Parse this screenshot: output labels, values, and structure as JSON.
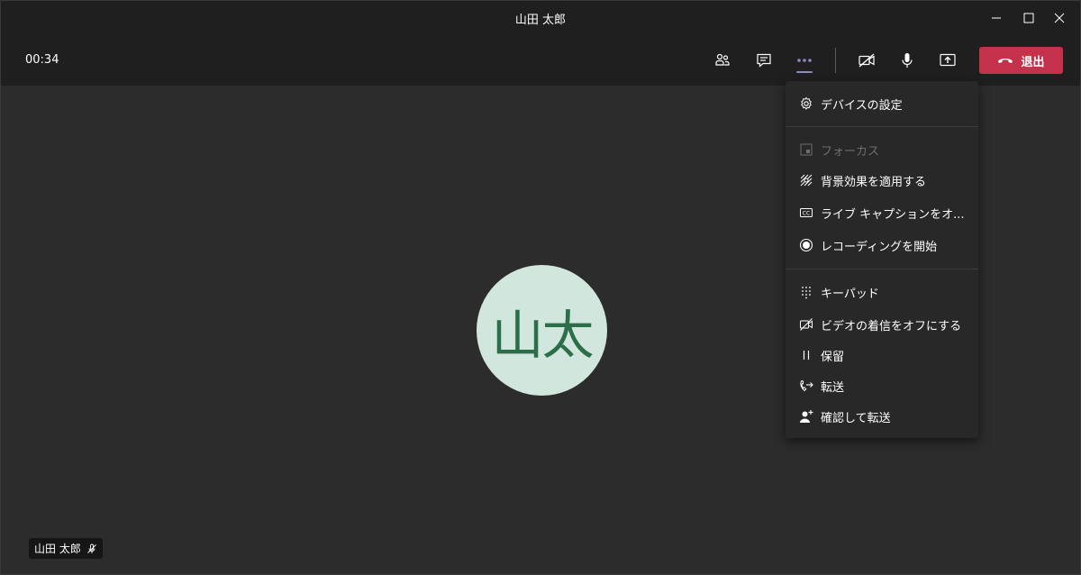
{
  "window": {
    "title": "山田 太郎"
  },
  "toolbar": {
    "timer": "00:34",
    "leave_label": "退出",
    "leave_color": "#c4314b",
    "icons": [
      "participants-icon",
      "chat-icon",
      "more-actions-icon",
      "camera-off-icon",
      "microphone-icon",
      "share-screen-icon"
    ]
  },
  "menu": {
    "items": [
      {
        "label": "デバイスの設定",
        "icon": "gear-icon"
      },
      {
        "label": "フォーカス",
        "icon": "focus-icon",
        "disabled": true
      },
      {
        "label": "背景効果を適用する",
        "icon": "background-effects-icon"
      },
      {
        "label": "ライブ キャプションをオ...",
        "icon": "cc-icon"
      },
      {
        "label": "レコーディングを開始",
        "icon": "record-icon"
      },
      {
        "label": "キーパッド",
        "icon": "keypad-icon"
      },
      {
        "label": "ビデオの着信をオフにする",
        "icon": "video-off-icon"
      },
      {
        "label": "保留",
        "icon": "pause-icon"
      },
      {
        "label": "転送",
        "icon": "transfer-icon"
      },
      {
        "label": "確認して転送",
        "icon": "consult-transfer-icon"
      }
    ]
  },
  "stage": {
    "avatar_initials": "山太",
    "avatar_bg": "#d1e7dd",
    "avatar_fg": "#2c6e49",
    "name_tag": "山田 太郎"
  }
}
